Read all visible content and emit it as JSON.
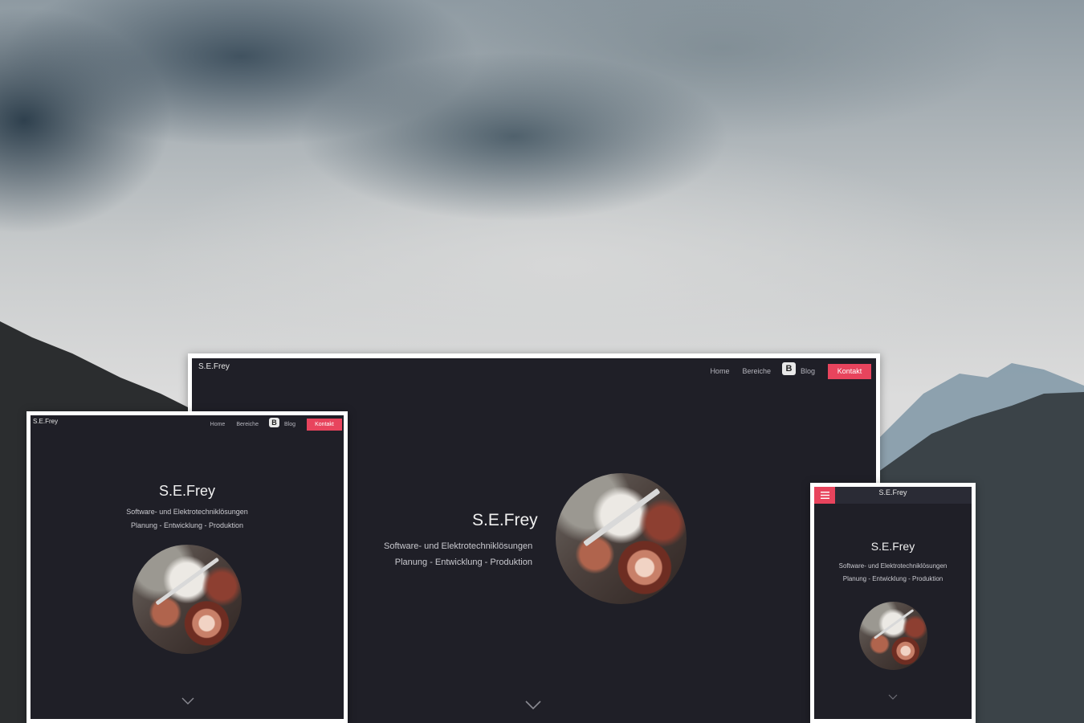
{
  "site": {
    "brand": "S.E.Frey",
    "title": "S.E.Frey",
    "tagline": "Software- und Elektrotechniklösungen",
    "subline": "Planung - Entwicklung - Produktion",
    "blog_icon_letter": "B"
  },
  "nav": {
    "home": "Home",
    "bereiche": "Bereiche",
    "blog": "Blog",
    "kontakt": "Kontakt"
  },
  "icons": {
    "menu": "hamburger-icon",
    "scroll_down": "chevron-down-icon",
    "blog": "blogger-icon"
  },
  "colors": {
    "screen_bg": "#1f1f27",
    "accent": "#e8445d",
    "frame": "#ffffff"
  }
}
